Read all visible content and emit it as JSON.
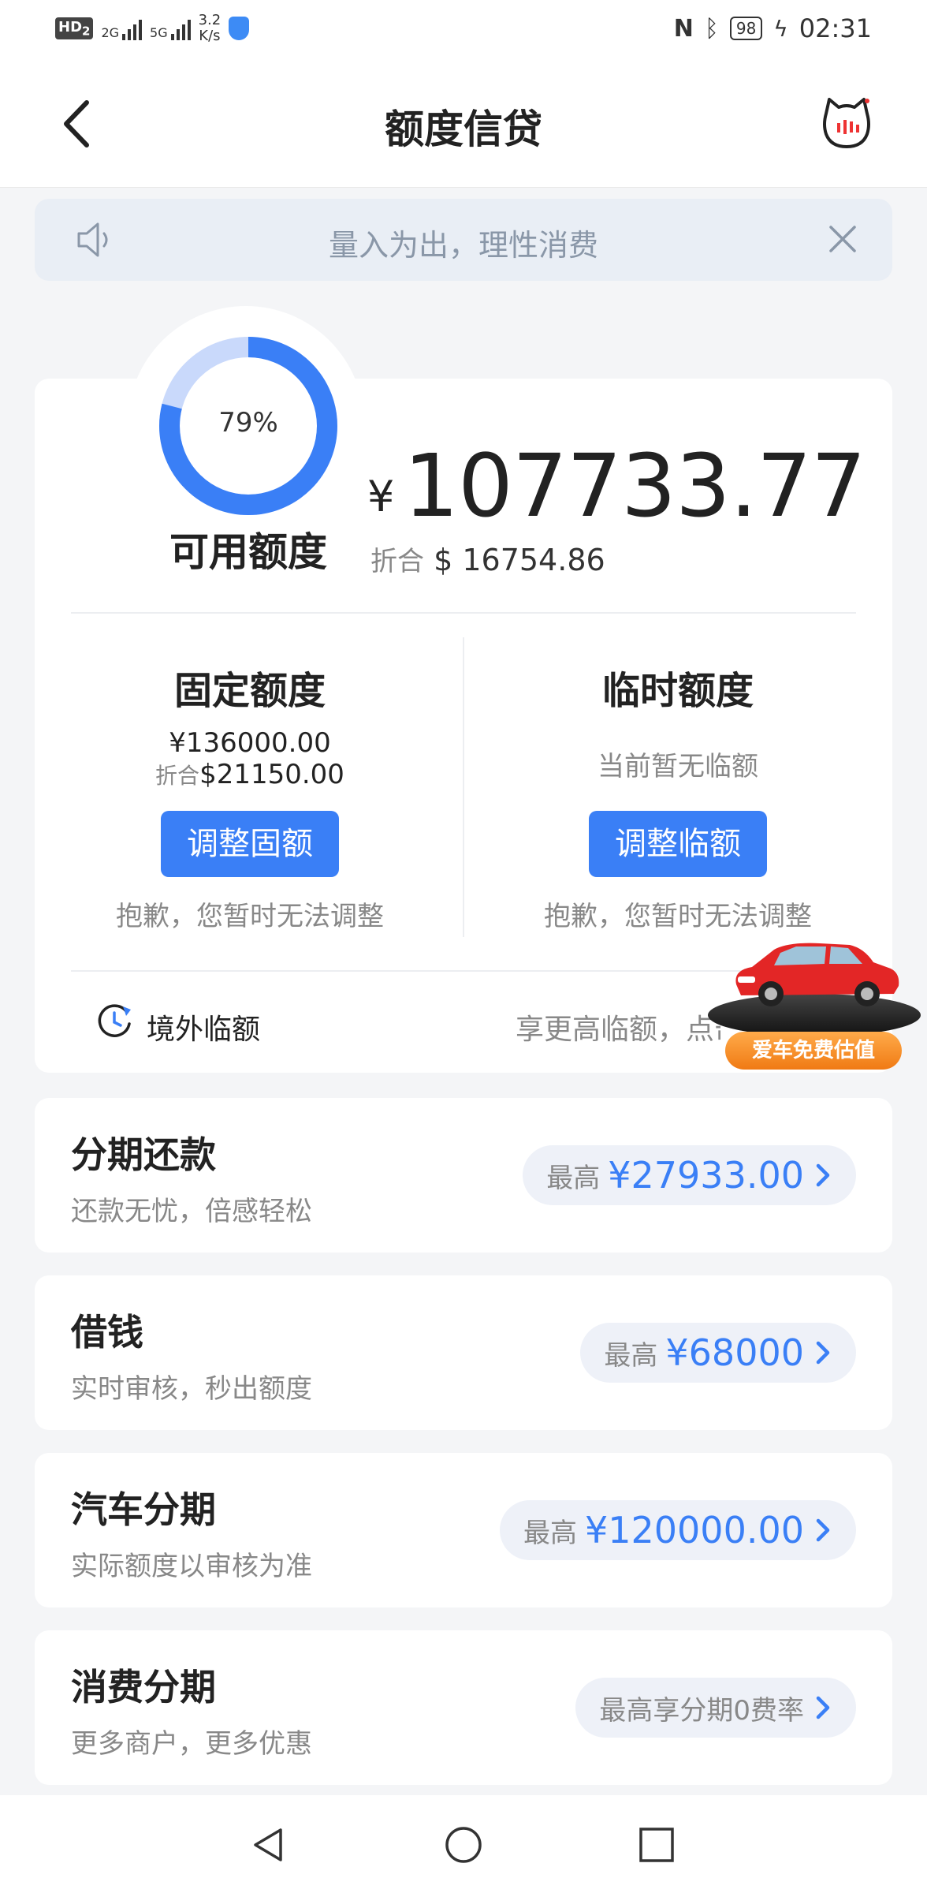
{
  "status_bar": {
    "hd": "HD",
    "hd_sub": "2",
    "net_2g": "2G",
    "net_5g": "5G",
    "speed_value": "3.2",
    "speed_unit": "K/s",
    "battery": "98",
    "time": "02:31",
    "icons": [
      "nfc-icon",
      "bluetooth-icon",
      "charging-icon",
      "shield-icon"
    ]
  },
  "header": {
    "title": "额度信贷",
    "back_icon": "back-chevron-icon",
    "mascot_icon": "cat-mascot-icon"
  },
  "notice": {
    "text": "量入为出，理性消费",
    "speaker_icon": "speaker-icon",
    "close_icon": "close-icon"
  },
  "credit": {
    "gauge_percent": 79,
    "gauge_label": "79%",
    "available_label": "可用额度",
    "currency_symbol": "¥",
    "available_amount": "107733.77",
    "conv_label": "折合",
    "conv_amount": "$ 16754.86",
    "colors": {
      "accent": "#3a7ff6",
      "gauge_track": "#c9d9fb"
    }
  },
  "fixed_limit": {
    "title": "固定额度",
    "amount": "¥136000.00",
    "conv_label": "折合",
    "conv_amount": "$21150.00",
    "button": "调整固额",
    "note": "抱歉，您暂时无法调整"
  },
  "temp_limit": {
    "title": "临时额度",
    "status": "当前暂无临额",
    "button": "调整临额",
    "note": "抱歉，您暂时无法调整"
  },
  "overseas": {
    "label": "境外临额",
    "hint": "享更高临额，点击",
    "icon": "clock-plane-icon"
  },
  "car_promo": {
    "badge": "爱车免费估值",
    "icon": "red-car-icon"
  },
  "products": [
    {
      "title": "分期还款",
      "subtitle": "还款无忧，倍感轻松",
      "pill_label": "最高",
      "pill_value": "¥27933.00"
    },
    {
      "title": "借钱",
      "subtitle": "实时审核，秒出额度",
      "pill_label": "最高",
      "pill_value": "¥68000"
    },
    {
      "title": "汽车分期",
      "subtitle": "实际额度以审核为准",
      "pill_label": "最高",
      "pill_value": "¥120000.00"
    },
    {
      "title": "消费分期",
      "subtitle": "更多商户，更多优惠",
      "pill_label": "最高享分期0费率",
      "pill_value": ""
    }
  ],
  "nav": {
    "back": "nav-back-icon",
    "home": "nav-home-icon",
    "recents": "nav-recents-icon"
  }
}
